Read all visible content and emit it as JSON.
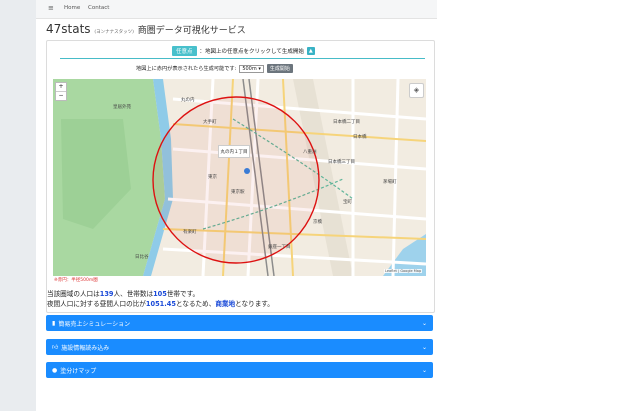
{
  "nav": {
    "menu_icon": "hamburger-icon",
    "items": [
      "Home",
      "Contact"
    ]
  },
  "title": {
    "brand": "47stats",
    "reading": "(ヨンナナスタッツ)",
    "subtitle": "商圏データ可視化サービス"
  },
  "tip": {
    "tag": "任意点",
    "text": "：地図上の任意点をクリックして生成開始",
    "chevron_icon": "chevron-up-icon"
  },
  "generate": {
    "label": "地図上に赤円が表示されたら生成可能です:",
    "radius_value": "500m",
    "button": "生成開始"
  },
  "map": {
    "zoom_in": "+",
    "zoom_out": "−",
    "popup": "丸の内１丁目",
    "legend": "※赤円：半径500m圏",
    "attribution": "Leaflet | Google Map",
    "circle_color": "#d11",
    "labels": [
      "皇居外苑",
      "丸の内",
      "八重洲",
      "日本橋",
      "京橋",
      "銀座一丁目",
      "有楽町",
      "東京",
      "大手町",
      "宝町",
      "日比谷",
      "日本橋三丁目",
      "茅場町",
      "東京駅",
      "日本橋二丁目"
    ]
  },
  "info": {
    "l1_pre": "当該圏域の人口は",
    "population": "139",
    "l1_mid": "人、世帯数は",
    "households": "105",
    "l1_post": "世帯です。",
    "l2_pre": "夜間人口に対する昼間人口の比が",
    "ratio": "1051.45",
    "l2_mid": "となるため、",
    "area_type": "商業地",
    "l2_post": "となります。"
  },
  "accordion": [
    {
      "icon": "bar-chart-icon",
      "label": "簡易売上シミュレーション"
    },
    {
      "icon": "thumbs-up-icon",
      "label": "施設情報読み込み"
    },
    {
      "icon": "map-pin-icon",
      "label": "塗分けマップ"
    }
  ]
}
